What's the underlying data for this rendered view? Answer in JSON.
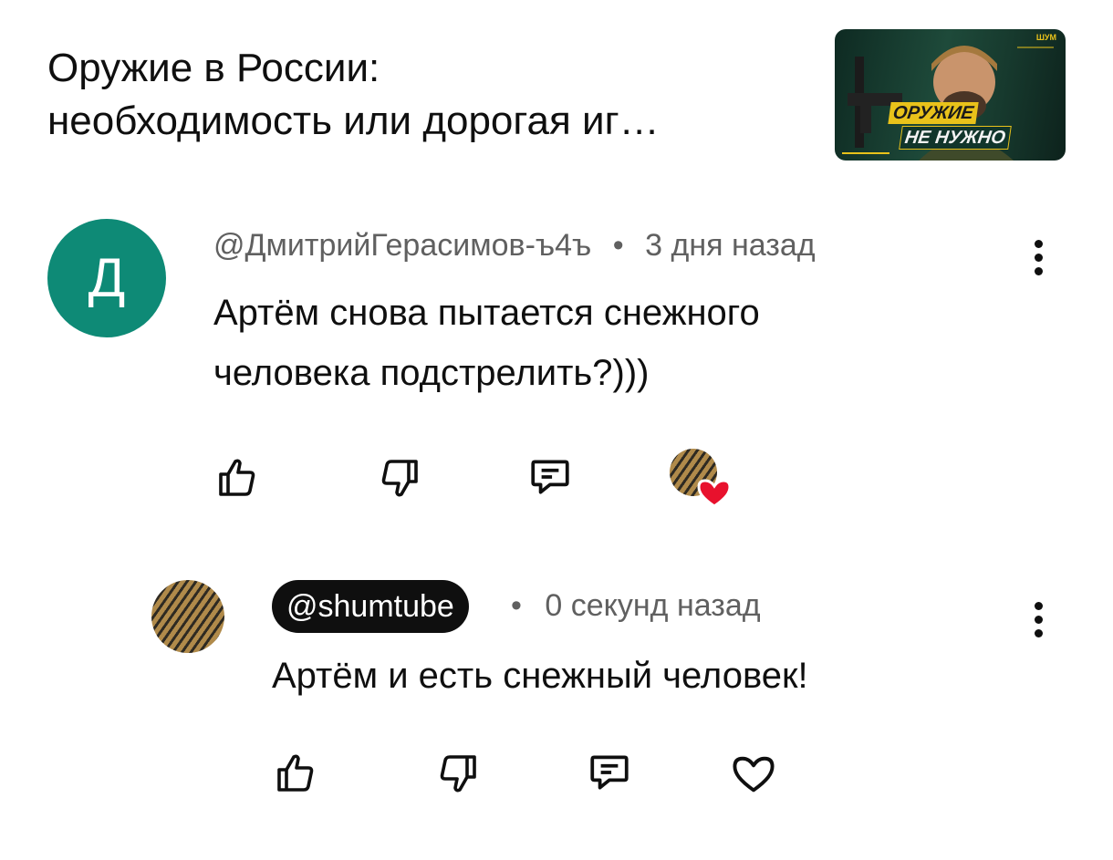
{
  "video": {
    "title": "Оружие в России:\nнеобходимость или дорогая иг…",
    "thumbnail": {
      "line1": "ОРУЖИЕ",
      "line2": "НЕ НУЖНО",
      "brand": "ШУМ"
    }
  },
  "comments": [
    {
      "avatar_letter": "Д",
      "avatar_color": "#0e8a76",
      "author": "@ДмитрийГерасимов-ъ4ъ",
      "separator": "•",
      "time": "3 дня назад",
      "text": "Артём снова пытается снежного человека подстрелить?)))",
      "actions": [
        "like-icon",
        "dislike-icon",
        "reply-icon",
        "creator-heart-icon"
      ]
    },
    {
      "author": "@shumtube",
      "separator": "•",
      "time": "0 секунд назад",
      "text": "Артём и есть снежный человек!",
      "actions": [
        "like-icon",
        "dislike-icon",
        "reply-icon",
        "heart-icon"
      ]
    }
  ],
  "colors": {
    "heart": "#e8112d",
    "meta_text": "#606060",
    "handle_pill": "#0f0f0f"
  }
}
